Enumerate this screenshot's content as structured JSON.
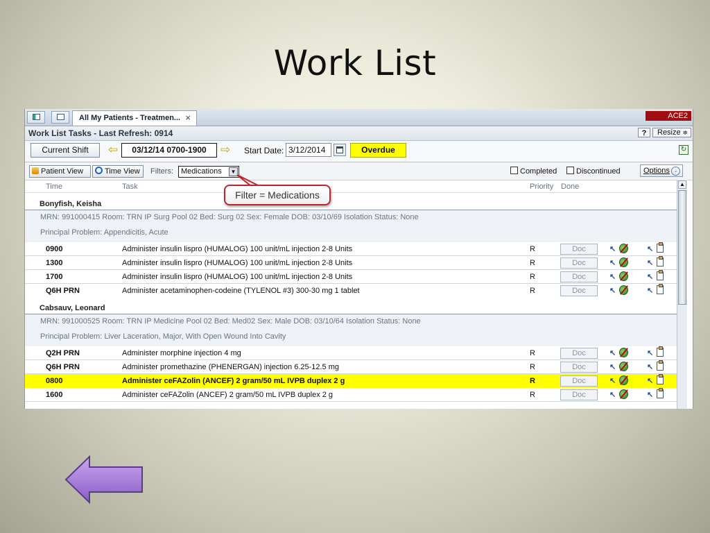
{
  "slide": {
    "title": "Work List"
  },
  "tabs": {
    "active_label": "All My Patients - Treatmen...",
    "close_glyph": "×",
    "env_badge": "ACE2"
  },
  "header": {
    "title": "Work List Tasks - Last Refresh: 0914",
    "help_label": "?",
    "resize_label": "Resize",
    "resize_glyph": "≑"
  },
  "shift": {
    "current_shift_label": "Current Shift",
    "prev_glyph": "⇦",
    "next_glyph": "⇨",
    "range": "03/12/14 0700-1900",
    "start_date_label": "Start Date:",
    "start_date_value": "3/12/2014",
    "overdue_label": "Overdue",
    "colors": {
      "overdue": "#ffff00"
    }
  },
  "toolbar": {
    "patient_view_label": "Patient View",
    "time_view_label": "Time View",
    "filters_label": "Filters:",
    "filter_selected": "Medications",
    "filter_dd_glyph": "▼",
    "completed_label": "Completed",
    "discontinued_label": "Discontinued",
    "options_label": "Options",
    "options_glyph": "⌄"
  },
  "columns": {
    "time": "Time",
    "task": "Task",
    "priority": "Priority",
    "done": "Done"
  },
  "callout": {
    "text": "Filter = Medications"
  },
  "patients": [
    {
      "name": "Bonyfish, Keisha",
      "info": "MRN: 991000415    Room: TRN IP Surg Pool 02    Bed: Surg 02    Sex: Female    DOB: 03/10/69    Isolation Status: None",
      "problem": "Principal Problem: Appendicitis, Acute",
      "tasks": [
        {
          "time": "0900",
          "desc": "Administer insulin lispro (HUMALOG) 100 unit/mL injection 2-8 Units",
          "priority": "R",
          "doc": "Doc"
        },
        {
          "time": "1300",
          "desc": "Administer insulin lispro (HUMALOG) 100 unit/mL injection 2-8 Units",
          "priority": "R",
          "doc": "Doc"
        },
        {
          "time": "1700",
          "desc": "Administer insulin lispro (HUMALOG) 100 unit/mL injection 2-8 Units",
          "priority": "R",
          "doc": "Doc"
        },
        {
          "time": "Q6H PRN",
          "desc": "Administer acetaminophen-codeine (TYLENOL #3) 300-30 mg 1 tablet",
          "priority": "R",
          "doc": "Doc"
        }
      ]
    },
    {
      "name": "Cabsauv, Leonard",
      "info": "MRN: 991000525    Room: TRN IP Medicine Pool 02    Bed: Med02    Sex: Male    DOB: 03/10/64    Isolation Status: None",
      "problem": "Principal Problem: Liver Laceration, Major, With Open Wound Into Cavity",
      "tasks": [
        {
          "time": "Q2H PRN",
          "desc": "Administer morphine injection 4 mg",
          "priority": "R",
          "doc": "Doc"
        },
        {
          "time": "Q6H PRN",
          "desc": "Administer promethazine (PHENERGAN) injection 6.25-12.5 mg",
          "priority": "R",
          "doc": "Doc"
        },
        {
          "time": "0800",
          "desc": "Administer ceFAZolin (ANCEF) 2 gram/50 mL IVPB duplex 2 g",
          "priority": "R",
          "doc": "Doc",
          "highlight": true
        },
        {
          "time": "1600",
          "desc": "Administer ceFAZolin (ANCEF) 2 gram/50 mL IVPB duplex 2 g",
          "priority": "R",
          "doc": "Doc"
        }
      ]
    }
  ],
  "colors": {
    "accent_badge": "#a00e12",
    "highlight_row": "#ffff00",
    "callout_border": "#c0232c",
    "back_arrow": "#9b6fd0"
  }
}
